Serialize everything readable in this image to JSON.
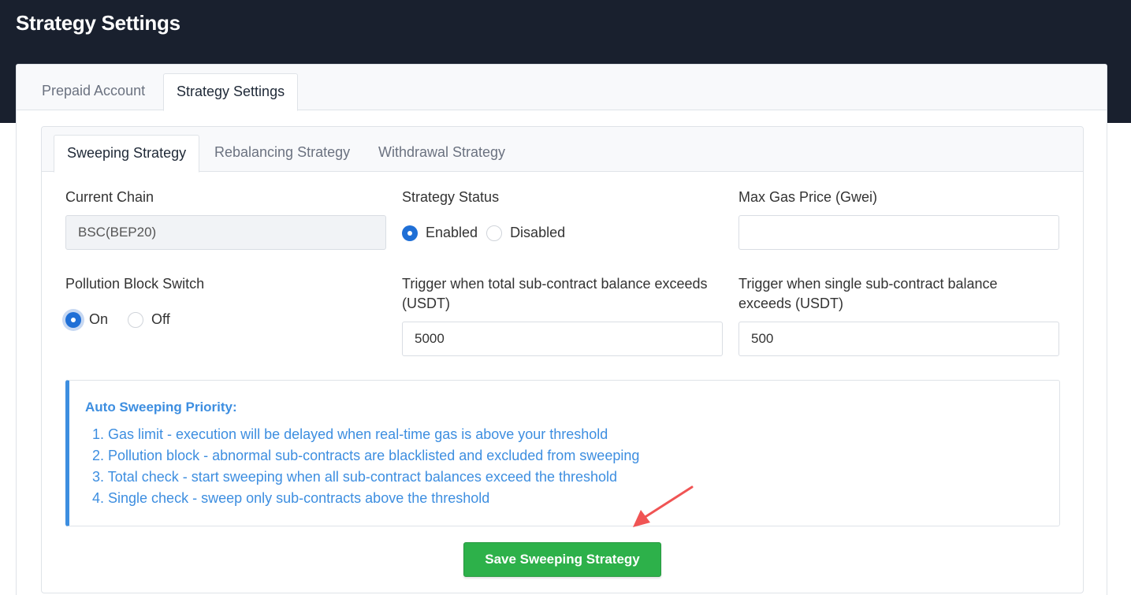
{
  "page": {
    "title": "Strategy Settings"
  },
  "tabs": [
    {
      "label": "Prepaid Account",
      "active": false
    },
    {
      "label": "Strategy Settings",
      "active": true
    }
  ],
  "sub_tabs": [
    {
      "label": "Sweeping Strategy",
      "active": true
    },
    {
      "label": "Rebalancing Strategy",
      "active": false
    },
    {
      "label": "Withdrawal Strategy",
      "active": false
    }
  ],
  "form": {
    "current_chain": {
      "label": "Current Chain",
      "value": "BSC(BEP20)"
    },
    "strategy_status": {
      "label": "Strategy Status",
      "options": [
        "Enabled",
        "Disabled"
      ],
      "selected": "Enabled"
    },
    "max_gas_price": {
      "label": "Max Gas Price (Gwei)",
      "value": ""
    },
    "pollution_block": {
      "label": "Pollution Block Switch",
      "options": [
        "On",
        "Off"
      ],
      "selected": "On"
    },
    "total_trigger": {
      "label_line1": "Trigger when total sub-contract balance exceeds",
      "label_line2": "(USDT)",
      "value": "5000"
    },
    "single_trigger": {
      "label_line1": "Trigger when single sub-contract balance",
      "label_line2": "exceeds (USDT)",
      "value": "500"
    }
  },
  "priority": {
    "title": "Auto Sweeping Priority:",
    "items": [
      "1. Gas limit - execution will be delayed when real-time gas is above your threshold",
      "2. Pollution block - abnormal sub-contracts are blacklisted and excluded from sweeping",
      "3. Total check - start sweeping when all sub-contract balances exceed the threshold",
      "4. Single check - sweep only sub-contracts above the threshold"
    ]
  },
  "actions": {
    "save_label": "Save Sweeping Strategy"
  },
  "colors": {
    "header_bg": "#19202e",
    "accent_blue": "#1f6fd6",
    "info_blue": "#3d8ee0",
    "save_green": "#2db14a",
    "annotation_arrow": "#f05454"
  }
}
